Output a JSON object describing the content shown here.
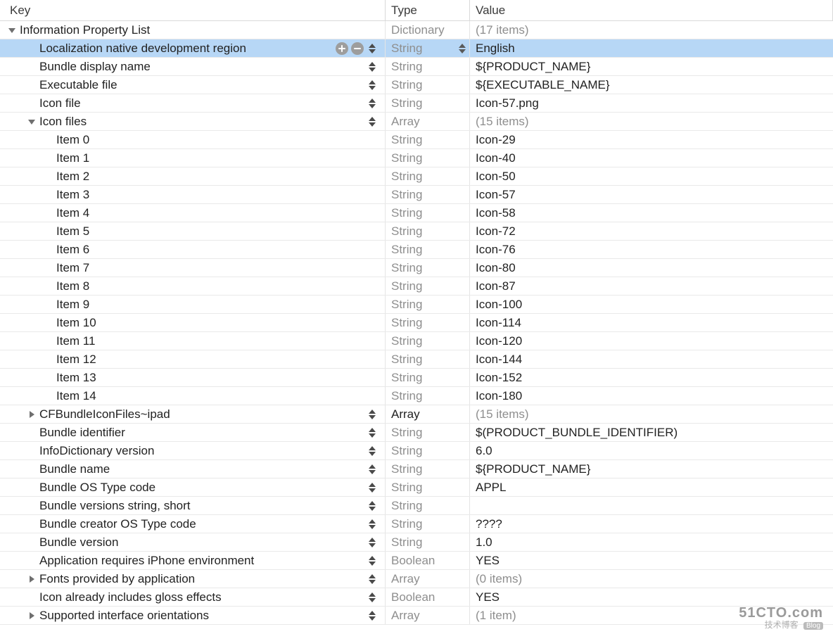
{
  "header": {
    "key": "Key",
    "type": "Type",
    "value": "Value"
  },
  "root": {
    "key": "Information Property List",
    "type": "Dictionary",
    "value": "(17 items)"
  },
  "rows": [
    {
      "indent": 1,
      "tri": "",
      "key": "Localization native development region",
      "type": "String",
      "value": "English",
      "selected": true,
      "stepper": true,
      "typeStepper": true,
      "addRemove": true
    },
    {
      "indent": 1,
      "tri": "",
      "key": "Bundle display name",
      "type": "String",
      "value": "${PRODUCT_NAME}",
      "stepper": true
    },
    {
      "indent": 1,
      "tri": "",
      "key": "Executable file",
      "type": "String",
      "value": "${EXECUTABLE_NAME}",
      "stepper": true
    },
    {
      "indent": 1,
      "tri": "",
      "key": "Icon file",
      "type": "String",
      "value": "Icon-57.png",
      "stepper": true
    },
    {
      "indent": 1,
      "tri": "down",
      "key": "Icon files",
      "type": "Array",
      "value": "(15 items)",
      "grayValue": true,
      "stepper": true
    },
    {
      "indent": 2,
      "tri": "",
      "key": "Item 0",
      "type": "String",
      "value": "Icon-29"
    },
    {
      "indent": 2,
      "tri": "",
      "key": "Item 1",
      "type": "String",
      "value": "Icon-40"
    },
    {
      "indent": 2,
      "tri": "",
      "key": "Item 2",
      "type": "String",
      "value": "Icon-50"
    },
    {
      "indent": 2,
      "tri": "",
      "key": "Item 3",
      "type": "String",
      "value": "Icon-57"
    },
    {
      "indent": 2,
      "tri": "",
      "key": "Item 4",
      "type": "String",
      "value": "Icon-58"
    },
    {
      "indent": 2,
      "tri": "",
      "key": "Item 5",
      "type": "String",
      "value": "Icon-72"
    },
    {
      "indent": 2,
      "tri": "",
      "key": "Item 6",
      "type": "String",
      "value": "Icon-76"
    },
    {
      "indent": 2,
      "tri": "",
      "key": "Item 7",
      "type": "String",
      "value": "Icon-80"
    },
    {
      "indent": 2,
      "tri": "",
      "key": "Item 8",
      "type": "String",
      "value": "Icon-87"
    },
    {
      "indent": 2,
      "tri": "",
      "key": "Item 9",
      "type": "String",
      "value": "Icon-100"
    },
    {
      "indent": 2,
      "tri": "",
      "key": "Item 10",
      "type": "String",
      "value": "Icon-114"
    },
    {
      "indent": 2,
      "tri": "",
      "key": "Item 11",
      "type": "String",
      "value": "Icon-120"
    },
    {
      "indent": 2,
      "tri": "",
      "key": "Item 12",
      "type": "String",
      "value": "Icon-144"
    },
    {
      "indent": 2,
      "tri": "",
      "key": "Item 13",
      "type": "String",
      "value": "Icon-152"
    },
    {
      "indent": 2,
      "tri": "",
      "key": "Item 14",
      "type": "String",
      "value": "Icon-180"
    },
    {
      "indent": 1,
      "tri": "right",
      "key": "CFBundleIconFiles~ipad",
      "type": "Array",
      "typeBlack": true,
      "value": "(15 items)",
      "grayValue": true,
      "stepper": true
    },
    {
      "indent": 1,
      "tri": "",
      "key": "Bundle identifier",
      "type": "String",
      "value": "$(PRODUCT_BUNDLE_IDENTIFIER)",
      "stepper": true
    },
    {
      "indent": 1,
      "tri": "",
      "key": "InfoDictionary version",
      "type": "String",
      "value": "6.0",
      "stepper": true
    },
    {
      "indent": 1,
      "tri": "",
      "key": "Bundle name",
      "type": "String",
      "value": "${PRODUCT_NAME}",
      "stepper": true
    },
    {
      "indent": 1,
      "tri": "",
      "key": "Bundle OS Type code",
      "type": "String",
      "value": "APPL",
      "stepper": true
    },
    {
      "indent": 1,
      "tri": "",
      "key": "Bundle versions string, short",
      "type": "String",
      "value": "",
      "stepper": true
    },
    {
      "indent": 1,
      "tri": "",
      "key": "Bundle creator OS Type code",
      "type": "String",
      "value": "????",
      "stepper": true
    },
    {
      "indent": 1,
      "tri": "",
      "key": "Bundle version",
      "type": "String",
      "value": "1.0",
      "stepper": true
    },
    {
      "indent": 1,
      "tri": "",
      "key": "Application requires iPhone environment",
      "type": "Boolean",
      "value": "YES",
      "stepper": true
    },
    {
      "indent": 1,
      "tri": "right",
      "key": "Fonts provided by application",
      "type": "Array",
      "value": "(0 items)",
      "grayValue": true,
      "stepper": true
    },
    {
      "indent": 1,
      "tri": "",
      "key": "Icon already includes gloss effects",
      "type": "Boolean",
      "value": "YES",
      "stepper": true
    },
    {
      "indent": 1,
      "tri": "right",
      "key": "Supported interface orientations",
      "type": "Array",
      "value": "(1 item)",
      "grayValue": true,
      "stepper": true
    }
  ],
  "watermark": {
    "line1": "51CTO.com",
    "line2": "技术博客",
    "badge": "Blog"
  }
}
